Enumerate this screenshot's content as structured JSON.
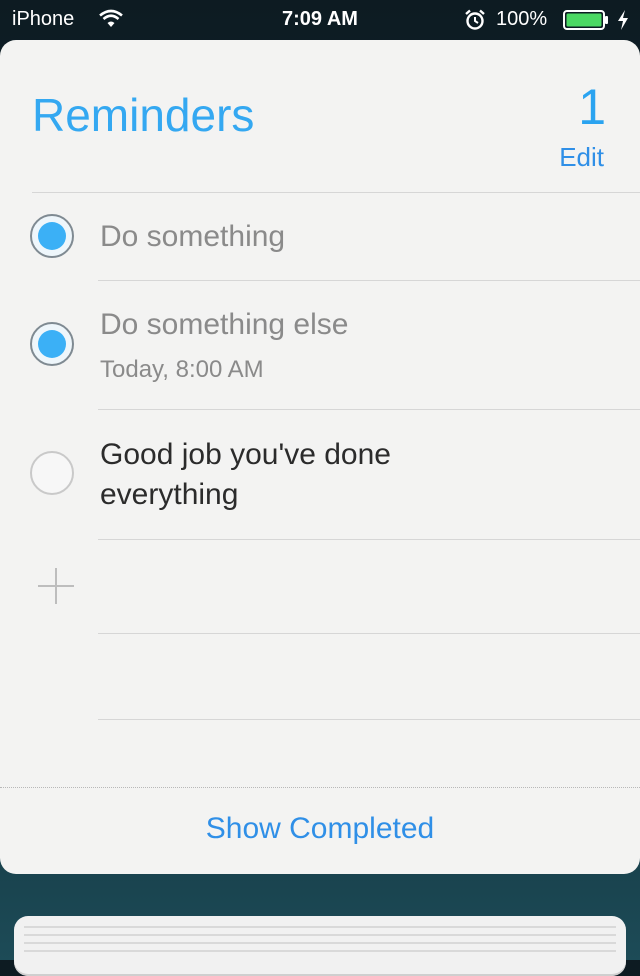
{
  "status_bar": {
    "carrier": "iPhone",
    "time": "7:09 AM",
    "battery_percent": "100%"
  },
  "widget": {
    "title": "Reminders",
    "count": "1",
    "edit_label": "Edit",
    "items": [
      {
        "title": "Do something",
        "subtitle": "",
        "completed": true
      },
      {
        "title": "Do something else",
        "subtitle": "Today, 8:00 AM",
        "completed": true
      },
      {
        "title": "Good job you've done everything",
        "subtitle": "",
        "completed": false
      }
    ],
    "show_completed_label": "Show Completed"
  },
  "colors": {
    "accent": "#2f8fe7",
    "title": "#34a8f1",
    "checked_fill": "#3bb0f6"
  },
  "icons": [
    "wifi-icon",
    "alarm-icon",
    "battery-icon",
    "charging-bolt-icon",
    "add-icon"
  ]
}
